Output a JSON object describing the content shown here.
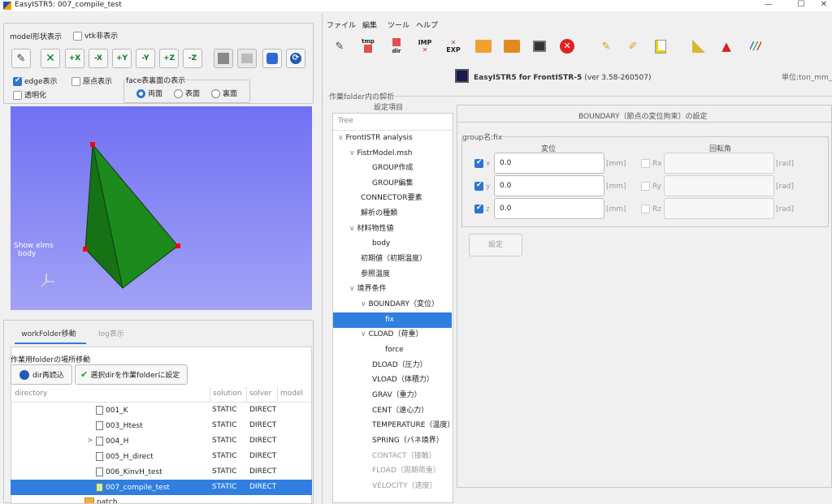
{
  "title_bar": {
    "title": "EasyISTR5: 007_compile_test",
    "minimize": "—",
    "maximize": "☐",
    "close": "✕"
  },
  "left": {
    "model_display": "model形状表示",
    "vtk_hide": "vtk非表示",
    "view_buttons": [
      "✎",
      "✕",
      "+X",
      "-X",
      "+Y",
      "-Y",
      "+Z",
      "-Z"
    ],
    "edge_display": "edge表示",
    "origin_display": "原点表示",
    "transparent": "透明化",
    "face_group_title": "face表裏面の表示",
    "face_both": "両面",
    "face_front": "表面",
    "face_back": "裏面",
    "viewer_label_line1": "Show elms",
    "viewer_label_line2": "body",
    "tabs": {
      "workfolder": "workFolder移動",
      "log": "log表示"
    },
    "move_label": "作業用folderの場所移動",
    "reload_btn": "dir再読込",
    "set_folder_btn": "選択dirを作業folderに設定",
    "table_headers": [
      "directory",
      "solution",
      "solver",
      "model"
    ],
    "rows": [
      {
        "name": "001_K",
        "solution": "STATIC",
        "solver": "DIRECT"
      },
      {
        "name": "003_Htest",
        "solution": "STATIC",
        "solver": "DIRECT"
      },
      {
        "name": "004_H",
        "solution": "STATIC",
        "solver": "DIRECT"
      },
      {
        "name": "005_H_direct",
        "solution": "STATIC",
        "solver": "DIRECT"
      },
      {
        "name": "006_KinvH_test",
        "solution": "STATIC",
        "solver": "DIRECT"
      },
      {
        "name": "007_compile_test",
        "solution": "STATIC",
        "solver": "DIRECT"
      },
      {
        "name": "patch",
        "solution": "",
        "solver": ""
      }
    ],
    "expander": ">"
  },
  "right": {
    "menu": [
      "ファイル",
      "編集",
      "ツール",
      "ヘルプ"
    ],
    "toolbar_labels": {
      "tmp": "tmp",
      "dir": "dir",
      "imp": "IMP",
      "exp": "EXP"
    },
    "app_heading": "EasyISTR5 for FrontISTR-5",
    "version": "(ver 3.58-260507)",
    "unit": "単位:ton_mm_s",
    "analysis_group": "作業folder内の解析",
    "settings_items": "設定項目",
    "tree_header": "Tree",
    "tree": [
      "FrontISTR analysis",
      "FistrModel.msh",
      "GROUP作成",
      "GROUP編集",
      "CONNECTOR要素",
      "解析の種類",
      "材料物性値",
      "body",
      "初期値（初期温度）",
      "参照温度",
      "境界条件",
      "BOUNDARY（変位）",
      "fix",
      "CLOAD（荷重）",
      "force",
      "DLOAD（圧力）",
      "VLOAD（体積力）",
      "GRAV（重力）",
      "CENT（遠心力）",
      "TEMPERATURE（温度）",
      "SPRING（バネ境界）",
      "CONTACT（接触）",
      "FLOAD（周期荷重）",
      "VELOCITY（速度）"
    ],
    "boundary_title": "BOUNDARY（節点の変位拘束）の設定",
    "group_name": "group名:fix",
    "disp_header": "変位",
    "rot_header": "回転角",
    "disp": [
      {
        "axis": "x",
        "value": "0.0"
      },
      {
        "axis": "y",
        "value": "0.0"
      },
      {
        "axis": "z",
        "value": "0.0"
      }
    ],
    "rot": [
      {
        "axis": "Rx"
      },
      {
        "axis": "Ry"
      },
      {
        "axis": "Rz"
      }
    ],
    "unit_mm": "[mm]",
    "unit_rad": "[rad]",
    "set_btn": "設定"
  },
  "colors": {
    "accent": "#2f7ee0",
    "viewer_top": "#7070f4",
    "model_green": "#1d8a1d",
    "node_red": "#ff0000"
  }
}
